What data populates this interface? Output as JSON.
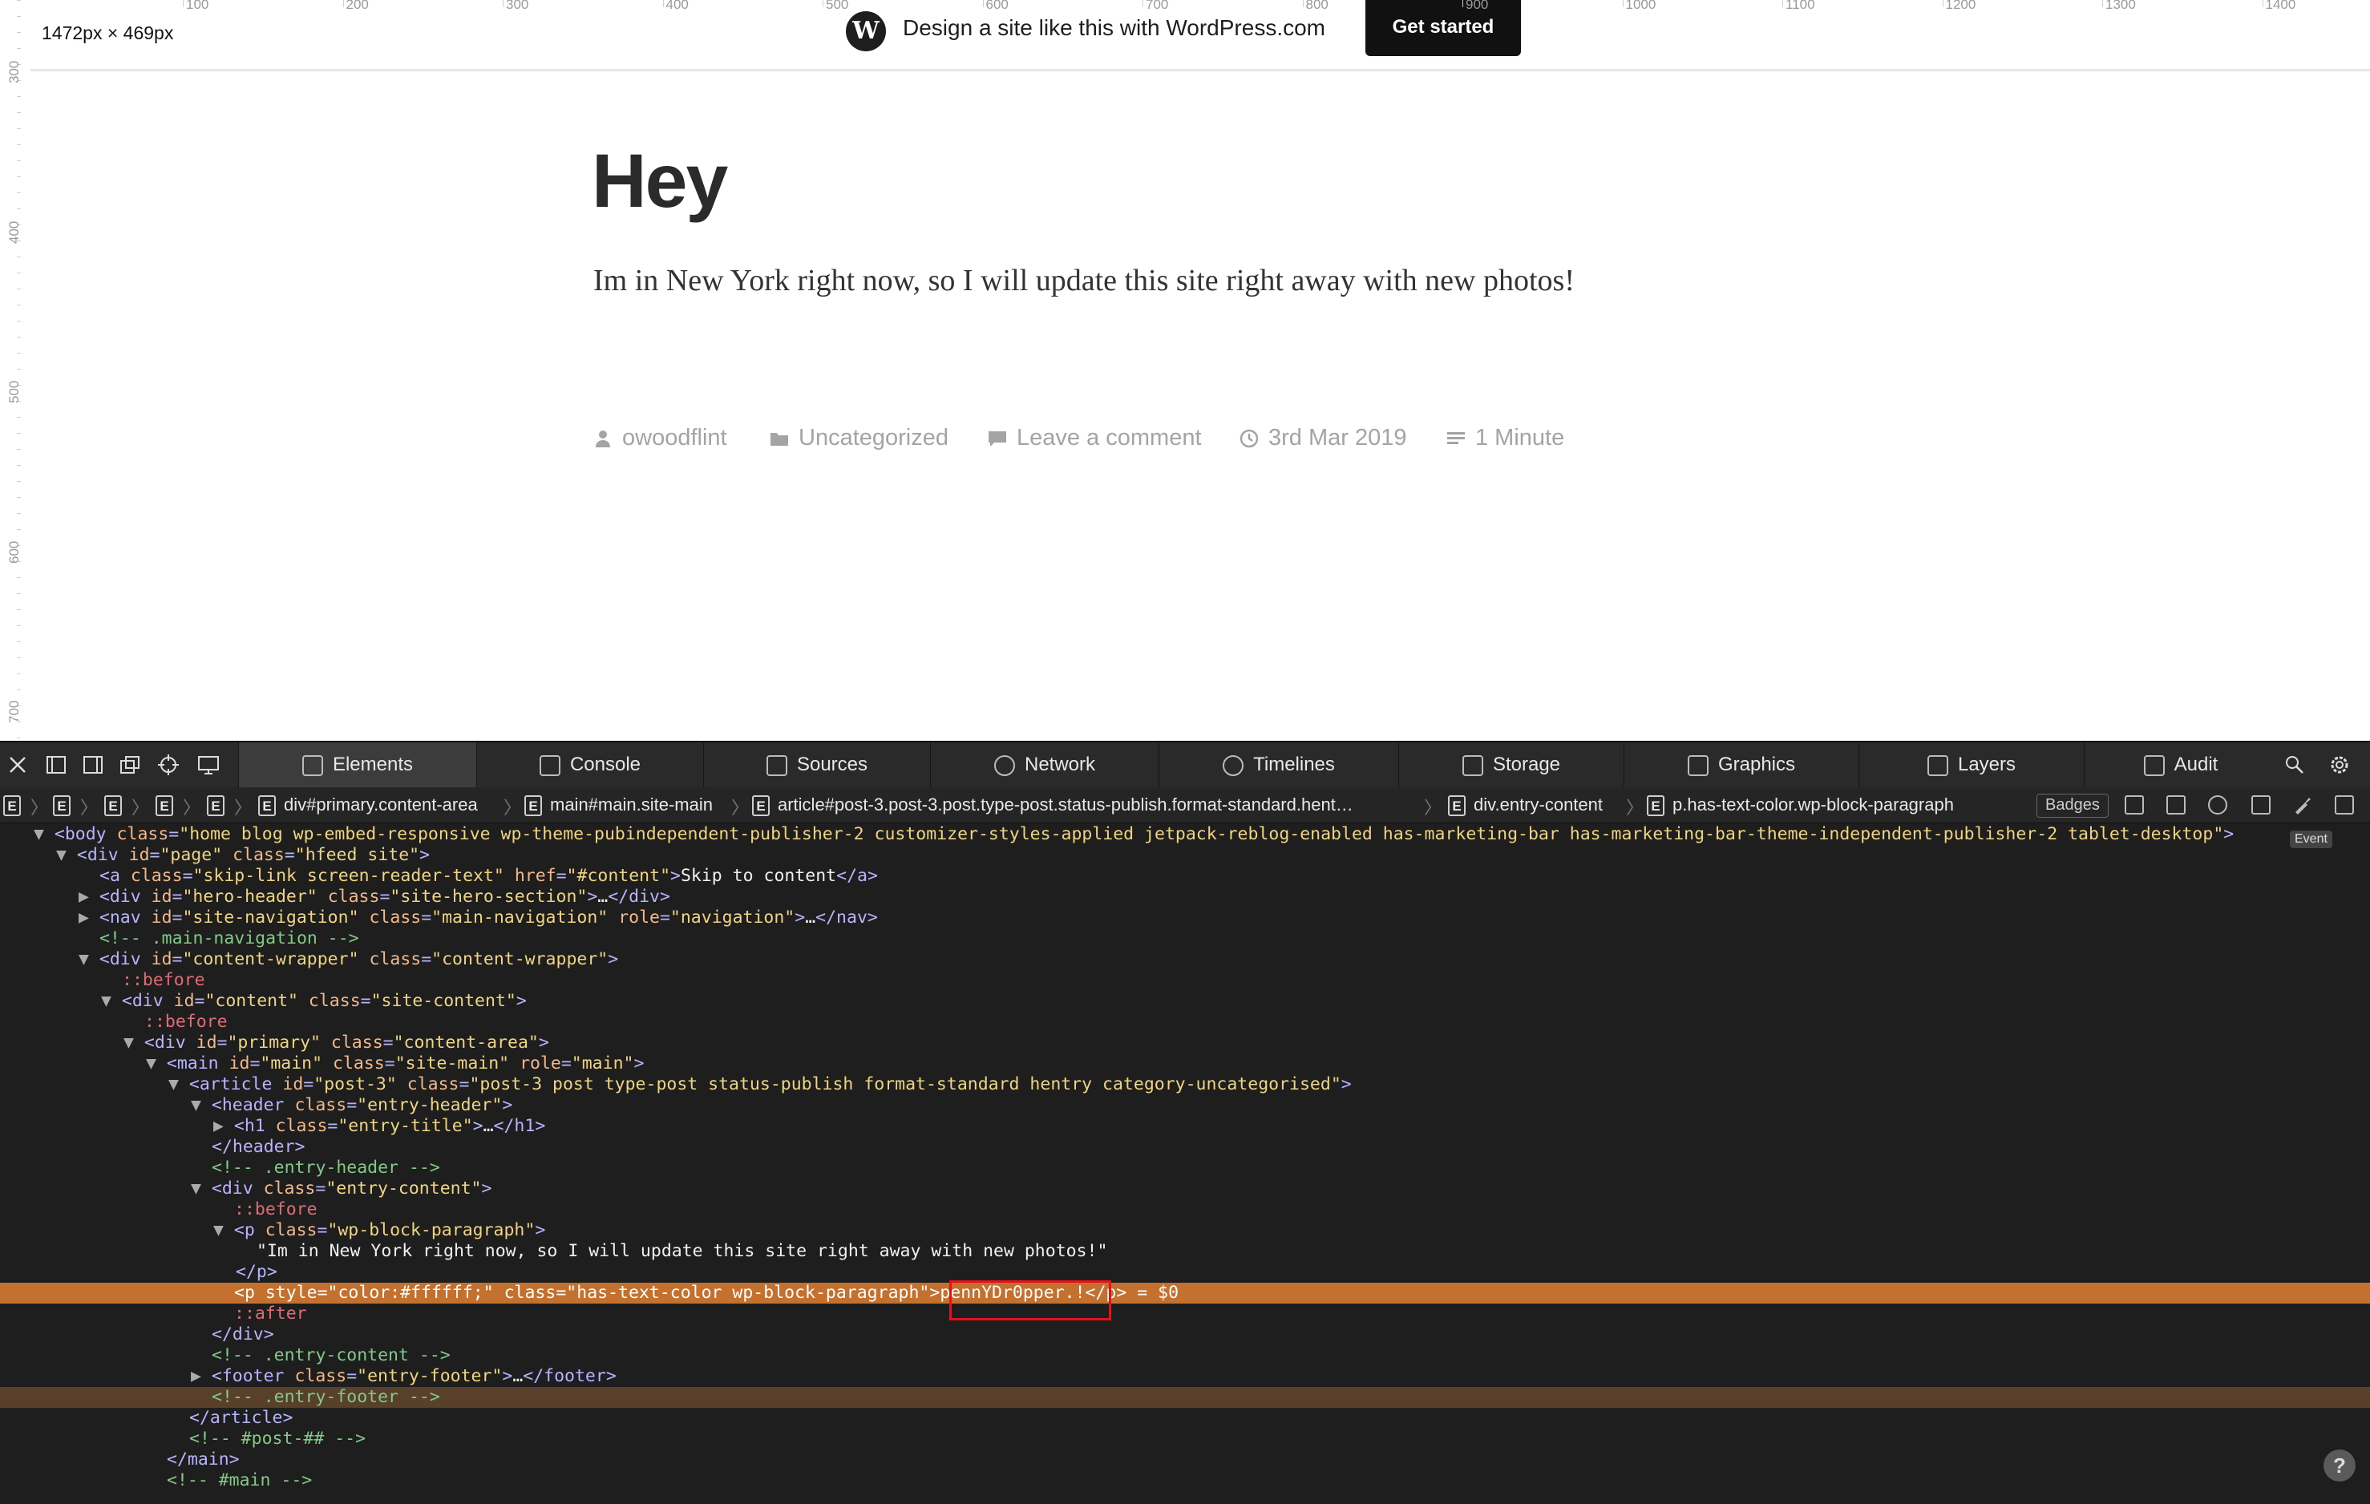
{
  "viewport": {
    "dimensions": "1472px × 469px",
    "ruler_top": [
      "100",
      "200",
      "300",
      "400",
      "500",
      "600",
      "700",
      "800",
      "900",
      "1000",
      "1100",
      "1200",
      "1300",
      "1400"
    ],
    "ruler_left": [
      "300",
      "400",
      "500",
      "600",
      "700"
    ]
  },
  "wp_bar": {
    "logo_icon": "wordpress-logo-icon",
    "text": "Design a site like this with WordPress.com",
    "button": "Get started"
  },
  "post": {
    "title": "Hey",
    "body": "Im in New York right now, so I will update this site right away with new photos!",
    "meta": {
      "author": "owoodflint",
      "category": "Uncategorized",
      "comments": "Leave a comment",
      "date": "3rd Mar 2019",
      "read_time": "1 Minute"
    }
  },
  "devtools": {
    "tabs": [
      {
        "label": "Elements",
        "icon": "elements-icon"
      },
      {
        "label": "Console",
        "icon": "console-icon"
      },
      {
        "label": "Sources",
        "icon": "sources-icon"
      },
      {
        "label": "Network",
        "icon": "network-icon"
      },
      {
        "label": "Timelines",
        "icon": "timelines-icon"
      },
      {
        "label": "Storage",
        "icon": "storage-icon"
      },
      {
        "label": "Graphics",
        "icon": "graphics-icon"
      },
      {
        "label": "Layers",
        "icon": "layers-icon"
      },
      {
        "label": "Audit",
        "icon": "audit-icon"
      }
    ],
    "breadcrumbs": [
      "div#primary.content-area",
      "main#main.site-main",
      "article#post-3.post-3.post.type-post.status-publish.format-standard.hent…",
      "div.entry-content",
      "p.has-text-color.wp-block-paragraph"
    ],
    "badges_label": "Badges",
    "event_badge": "Event",
    "help": "?",
    "dom": {
      "body_class": "home blog wp-embed-responsive wp-theme-pubindependent-publisher-2 customizer-styles-applied jetpack-reblog-enabled has-marketing-bar has-marketing-bar-theme-independent-publisher-2 tablet-desktop",
      "skip_link_href": "#content",
      "skip_link_text": "Skip to content",
      "comment_main_nav": "<!-- .main-navigation -->",
      "article_class": "post-3 post type-post status-publish format-standard hentry category-uncategorised",
      "paragraph_text": "\"Im in New York right now, so I will update this site right away with new photos!\"",
      "hidden_style": "color:#ffffff;",
      "hidden_class": "has-text-color wp-block-paragraph",
      "hidden_text": "pennYDr0pper.!",
      "selected_ref": "= $0",
      "comment_entry_header": "<!-- .entry-header -->",
      "comment_entry_content": "<!-- .entry-content -->",
      "comment_entry_footer": "<!-- .entry-footer -->",
      "comment_post": "<!-- #post-## -->",
      "comment_main": "<!-- #main -->"
    }
  }
}
